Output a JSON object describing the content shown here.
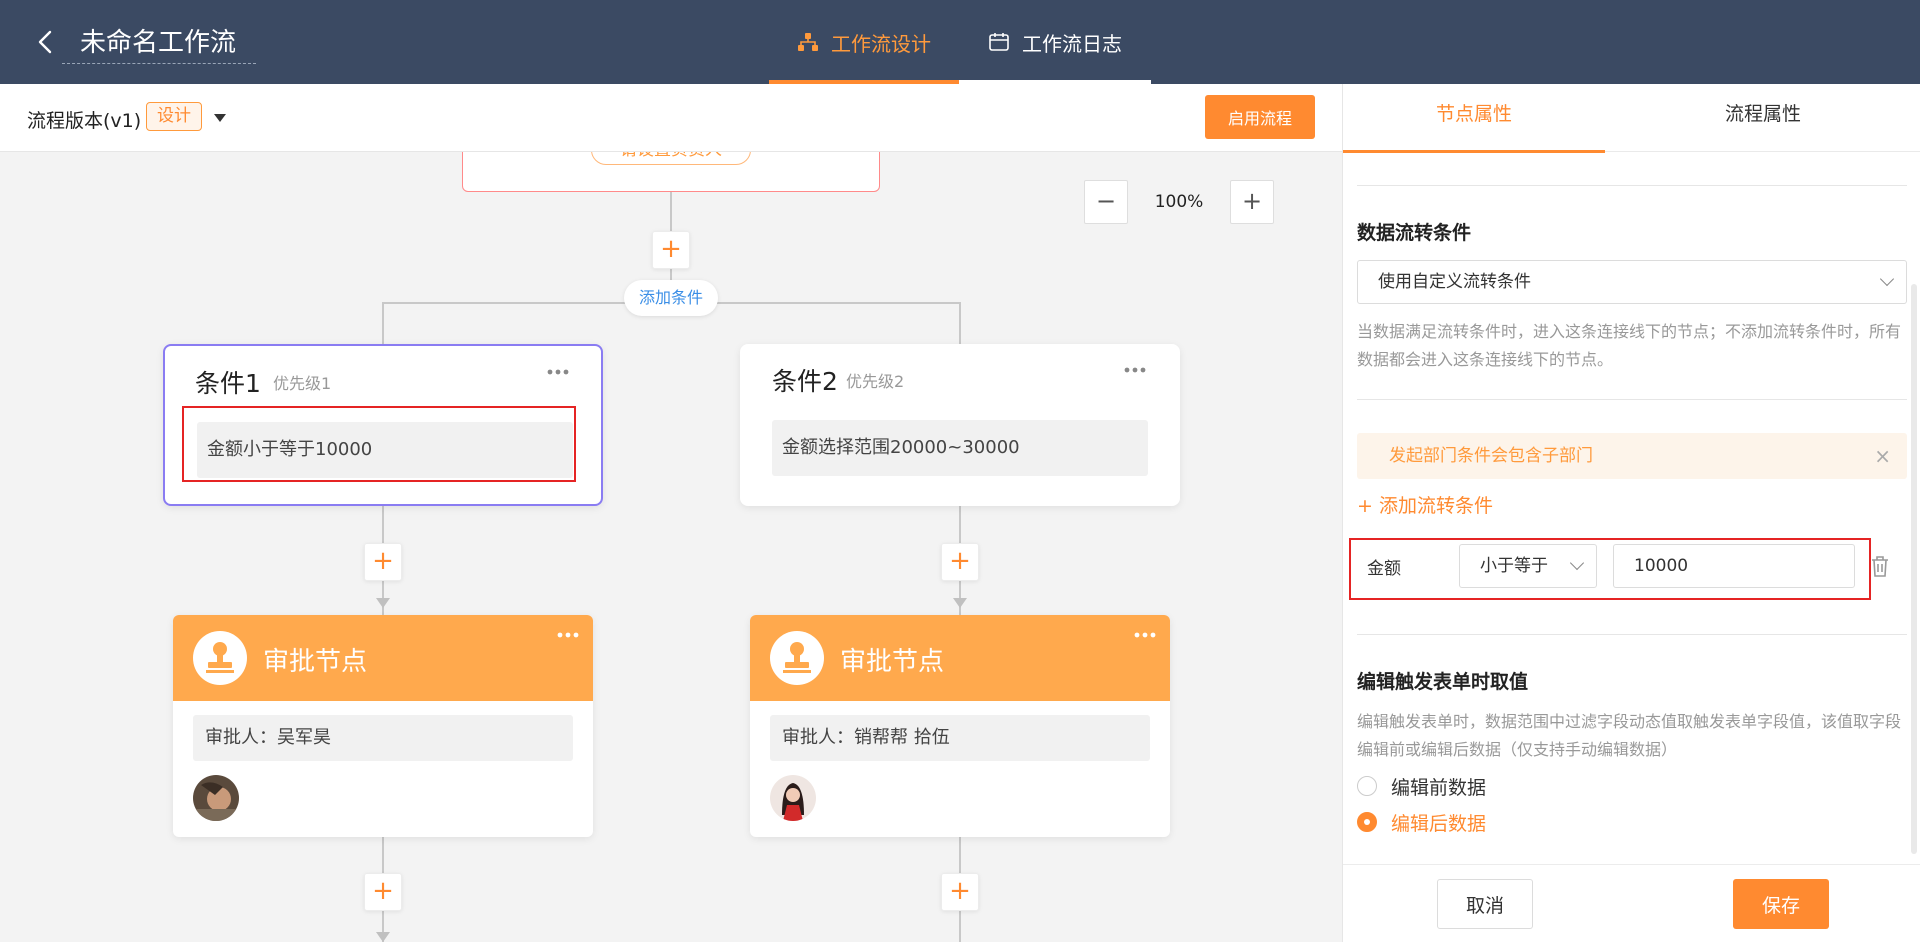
{
  "header": {
    "back_icon": "chevron-left-icon",
    "title": "未命名工作流",
    "tabs": [
      {
        "label": "工作流设计",
        "icon": "sitemap-icon",
        "active": true
      },
      {
        "label": "工作流日志",
        "icon": "calendar-icon",
        "active": false
      }
    ]
  },
  "subbar": {
    "version_label": "流程版本(v1)",
    "version_badge": "设计",
    "enable_button": "启用流程"
  },
  "canvas": {
    "top_node_pill": "请设置负责人",
    "zoom": {
      "minus": "−",
      "value": "100%",
      "plus": "+"
    },
    "add_condition": "添加条件",
    "plus": "+",
    "conditions": [
      {
        "title": "条件1",
        "priority": "优先级1",
        "rule": "金额小于等于10000",
        "selected": true
      },
      {
        "title": "条件2",
        "priority": "优先级2",
        "rule": "金额选择范围20000~30000",
        "selected": false
      }
    ],
    "approvals": [
      {
        "title": "审批节点",
        "approver": "审批人：吴军昊"
      },
      {
        "title": "审批节点",
        "approver": "审批人：销帮帮 拾伍"
      }
    ]
  },
  "panel": {
    "tabs": [
      {
        "label": "节点属性",
        "active": true
      },
      {
        "label": "流程属性",
        "active": false
      }
    ],
    "flow_condition": {
      "title": "数据流转条件",
      "select_value": "使用自定义流转条件",
      "hint": "当数据满足流转条件时，进入这条连接线下的节点；不添加流转条件时，所有数据都会进入这条连接线下的节点。",
      "notice": "发起部门条件会包含子部门",
      "notice_close": "×",
      "add_rule": "+ 添加流转条件",
      "rule": {
        "field": "金额",
        "operator": "小于等于",
        "value": "10000"
      }
    },
    "edit_trigger": {
      "title": "编辑触发表单时取值",
      "hint": "编辑触发表单时，数据范围中过滤字段动态值取触发表单字段值，该值取字段编辑前或编辑后数据（仅支持手动编辑数据）",
      "options": [
        {
          "label": "编辑前数据",
          "checked": false
        },
        {
          "label": "编辑后数据",
          "checked": true
        }
      ]
    },
    "footer": {
      "cancel": "取消",
      "save": "保存"
    }
  },
  "colors": {
    "header_bg": "#3b4a63",
    "accent": "#ff8a30",
    "approval_header": "#ffa94d",
    "selected_border": "#8a7cf2",
    "highlight_red": "#e52424",
    "link_blue": "#3a8ee6"
  }
}
